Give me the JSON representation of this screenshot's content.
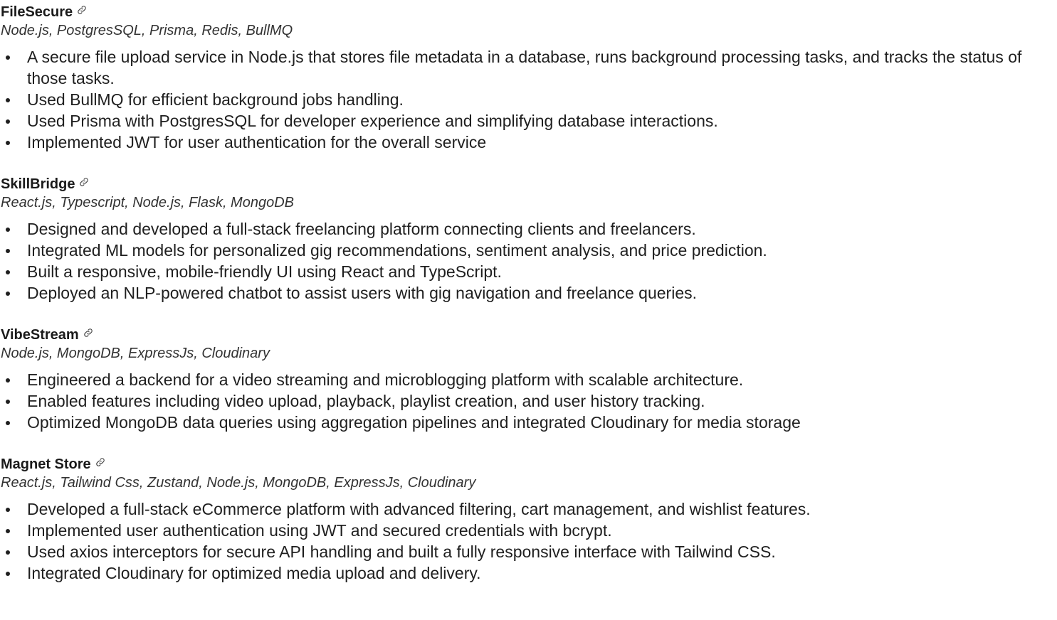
{
  "projects": [
    {
      "title": "FileSecure",
      "stack": "Node.js, PostgresSQL, Prisma, Redis, BullMQ",
      "bullets": [
        "A secure file upload service in Node.js that stores file metadata in a database, runs background processing tasks, and tracks the status of those tasks.",
        "Used BullMQ for efficient background jobs handling.",
        "Used Prisma with PostgresSQL for developer experience and simplifying database interactions.",
        "Implemented JWT for user authentication for the overall service"
      ]
    },
    {
      "title": "SkillBridge",
      "stack": "React.js, Typescript, Node.js, Flask, MongoDB",
      "bullets": [
        "Designed and developed a full-stack freelancing platform connecting clients and freelancers.",
        "Integrated ML models for personalized gig recommendations, sentiment analysis, and price prediction.",
        "Built a responsive, mobile-friendly UI using React and TypeScript.",
        "Deployed an NLP-powered chatbot to assist users with gig navigation and freelance queries."
      ]
    },
    {
      "title": "VibeStream",
      "stack": "Node.js, MongoDB, ExpressJs, Cloudinary",
      "bullets": [
        "Engineered a backend for a video streaming and microblogging platform with scalable architecture.",
        "Enabled features including video upload, playback, playlist creation, and user history tracking.",
        "Optimized MongoDB data queries using aggregation pipelines and integrated Cloudinary for media storage"
      ]
    },
    {
      "title": "Magnet Store",
      "stack": "React.js, Tailwind Css, Zustand, Node.js, MongoDB, ExpressJs, Cloudinary",
      "bullets": [
        "Developed a full-stack eCommerce platform with advanced filtering, cart management, and wishlist features.",
        "Implemented user authentication using JWT and secured credentials with bcrypt.",
        "Used axios interceptors for secure API handling and built a fully responsive interface with Tailwind CSS.",
        "Integrated Cloudinary for optimized media upload and delivery."
      ]
    }
  ],
  "icons": {
    "project_link": "link-icon"
  },
  "colors": {
    "text": "#1f1f1f",
    "heading": "#1a1a1a",
    "subtitle": "#333333",
    "background": "#ffffff"
  }
}
